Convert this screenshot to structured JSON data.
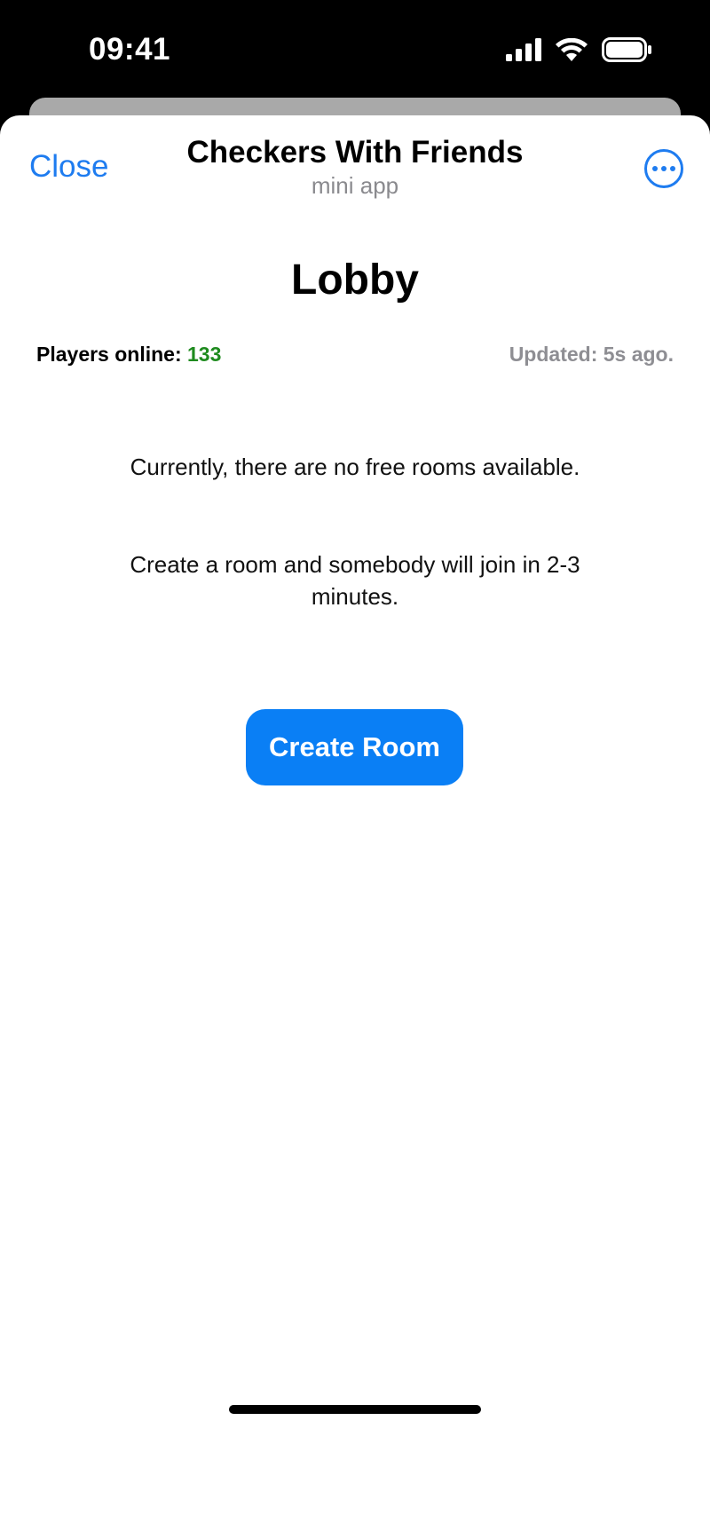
{
  "status_bar": {
    "time": "09:41"
  },
  "nav": {
    "close_label": "Close",
    "title": "Checkers With Friends",
    "subtitle": "mini app",
    "more_icon": "ellipsis-circle-icon"
  },
  "lobby": {
    "title": "Lobby",
    "players_label": "Players online:",
    "players_count": "133",
    "updated_text": "Updated: 5s ago.",
    "no_rooms_message": "Currently, there are no free rooms available.",
    "create_hint": "Create a room and somebody will join in 2-3 minutes.",
    "create_button_label": "Create Room"
  },
  "colors": {
    "accent": "#0a7ff5",
    "nav_link": "#1e7cf0",
    "players_count": "#1f8b1f",
    "muted": "#8e8e93"
  }
}
